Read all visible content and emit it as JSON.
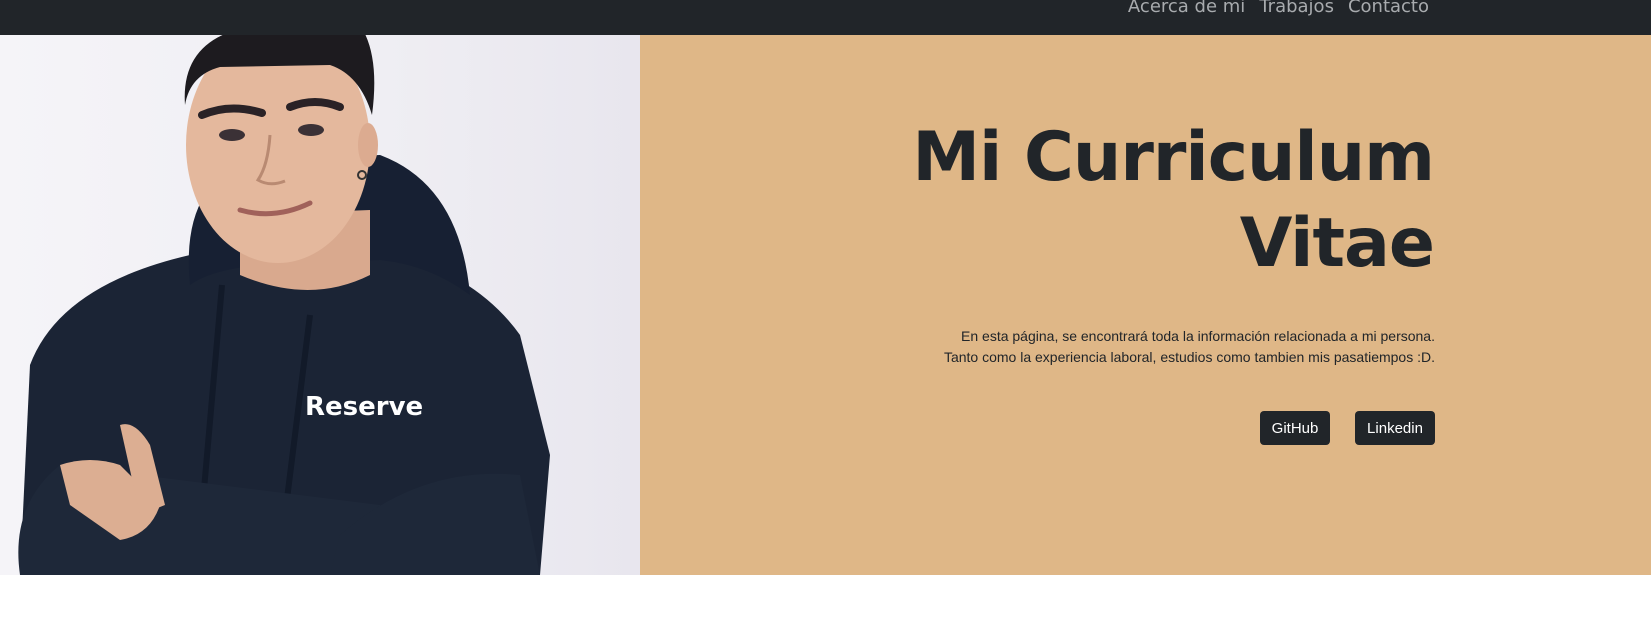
{
  "nav": {
    "links": [
      "Acerca de mi",
      "Trabajos",
      "Contacto"
    ]
  },
  "hero": {
    "title_line1": "Mi Curriculum",
    "title_line2": "Vitae",
    "description_line1": "En esta página, se encontrará toda la información relacionada a mi persona.",
    "description_line2": "Tanto como la experiencia laboral, estudios como tambien mis pasatiempos :D.",
    "buttons": {
      "github": "GitHub",
      "linkedin": "Linkedin"
    },
    "photo": {
      "hoodie_text": "Reserve"
    }
  },
  "colors": {
    "navbar": "#212529",
    "hero_background": "#dfb787",
    "title_text": "#212529",
    "button": "#212529"
  }
}
